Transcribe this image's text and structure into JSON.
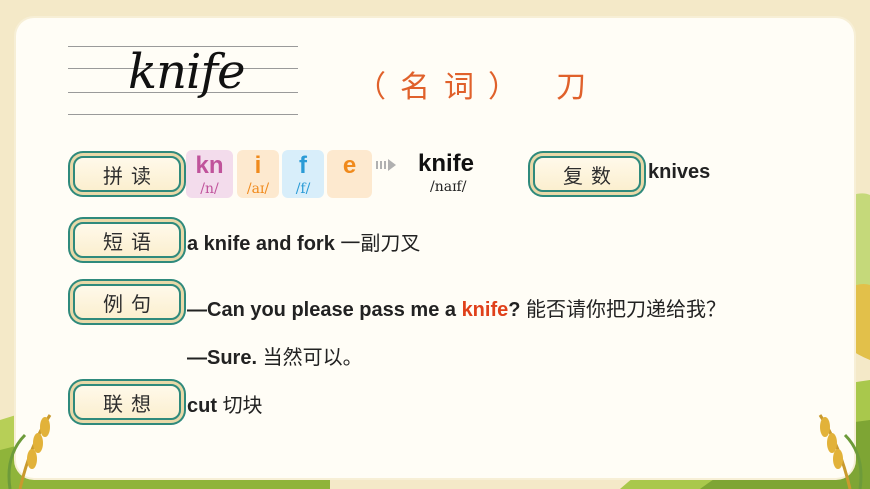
{
  "headword": "knife",
  "part_of_speech": "（名词）",
  "meaning": "刀",
  "labels": {
    "pronounce": "拼读",
    "plural": "复数",
    "phrase": "短语",
    "example": "例句",
    "associate": "联想"
  },
  "segments": [
    {
      "letters": "kn",
      "phonetic": "/n/",
      "color": "#c0539b",
      "bg": "#f3dcec"
    },
    {
      "letters": "i",
      "phonetic": "/aɪ/",
      "color": "#f08a1c",
      "bg": "#fde9cf"
    },
    {
      "letters": "f",
      "phonetic": "/f/",
      "color": "#2a9bd6",
      "bg": "#d8eefa"
    },
    {
      "letters": "e",
      "phonetic": "",
      "color": "#f08a1c",
      "bg": "#fde9cf"
    }
  ],
  "result_word": "knife",
  "result_phonetic": "/naɪf/",
  "plural_form": "knives",
  "phrase": {
    "en": "a knife and fork",
    "cn": "一副刀叉"
  },
  "example": {
    "q_prefix": "—Can you please pass me a ",
    "q_key": "knife",
    "q_suffix": "?",
    "q_cn": "能否请你把刀递给我？",
    "a_en": "—Sure.",
    "a_cn": "当然可以。"
  },
  "association": {
    "en": "cut",
    "cn": "切块"
  }
}
